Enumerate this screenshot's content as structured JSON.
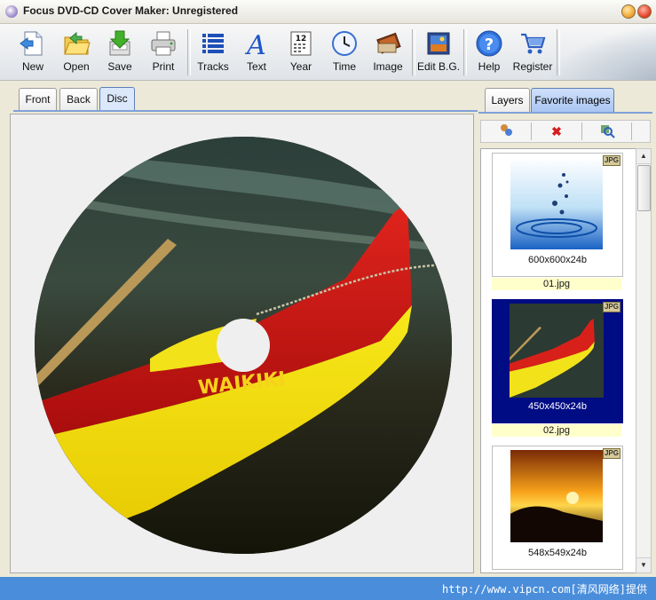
{
  "window": {
    "title": "Focus DVD-CD Cover Maker: Unregistered"
  },
  "toolbar": {
    "new": "New",
    "open": "Open",
    "save": "Save",
    "print": "Print",
    "tracks": "Tracks",
    "text": "Text",
    "year": "Year",
    "time": "Time",
    "image": "Image",
    "edit_bg": "Edit B.G.",
    "help": "Help",
    "register": "Register",
    "year_icon_number": "12"
  },
  "cover_tabs": {
    "front": "Front",
    "back": "Back",
    "disc": "Disc",
    "active": "Disc"
  },
  "side_tabs": {
    "layers": "Layers",
    "favorites": "Favorite images",
    "active": "Favorite images"
  },
  "disc_image": {
    "canoe_text": "WAIKIKI"
  },
  "favorites": [
    {
      "dims": "600x600x24b",
      "name": "01.jpg",
      "badge": "JPG",
      "selected": false
    },
    {
      "dims": "450x450x24b",
      "name": "02.jpg",
      "badge": "JPG",
      "selected": true
    },
    {
      "dims": "548x549x24b",
      "name": "",
      "badge": "JPG",
      "selected": false
    }
  ],
  "status": {
    "watermark": "http://www.vipcn.com[清风网络]提供"
  }
}
